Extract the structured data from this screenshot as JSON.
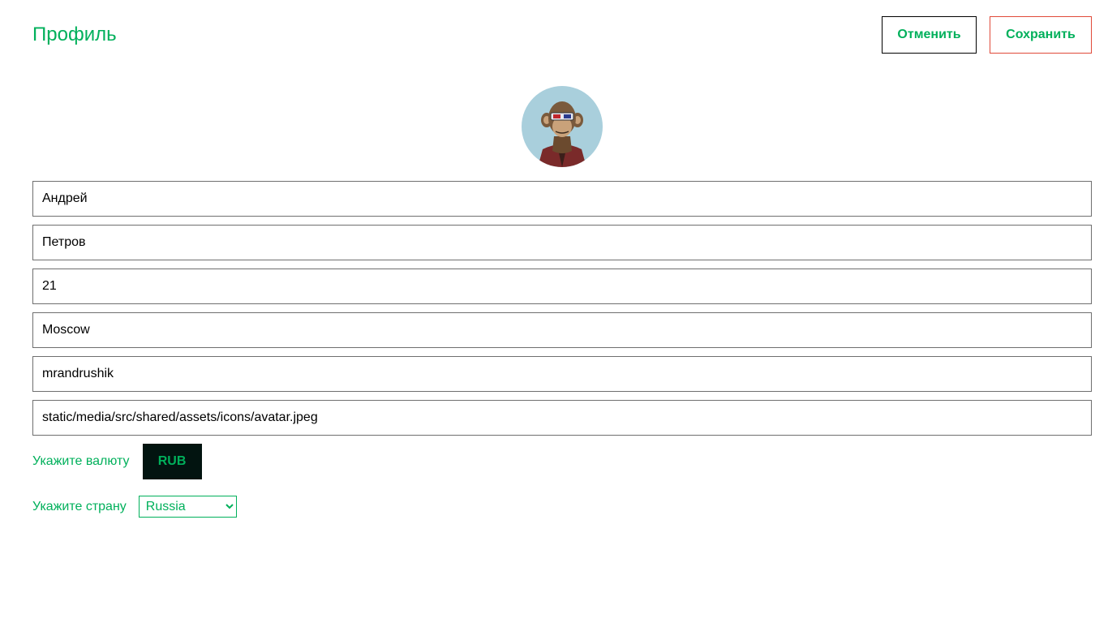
{
  "header": {
    "title": "Профиль",
    "cancel_label": "Отменить",
    "save_label": "Сохранить"
  },
  "avatar": {
    "description": "avatar"
  },
  "form": {
    "first_name": "Андрей",
    "last_name": "Петров",
    "age": "21",
    "city": "Moscow",
    "username": "mrandrushik",
    "avatar_path": "static/media/src/shared/assets/icons/avatar.jpeg"
  },
  "currency": {
    "label": "Укажите валюту",
    "value": "RUB"
  },
  "country": {
    "label": "Укажите страну",
    "selected": "Russia"
  },
  "colors": {
    "accent": "#00b05b",
    "save_border": "#e04a3a",
    "currency_bg": "#021410"
  }
}
